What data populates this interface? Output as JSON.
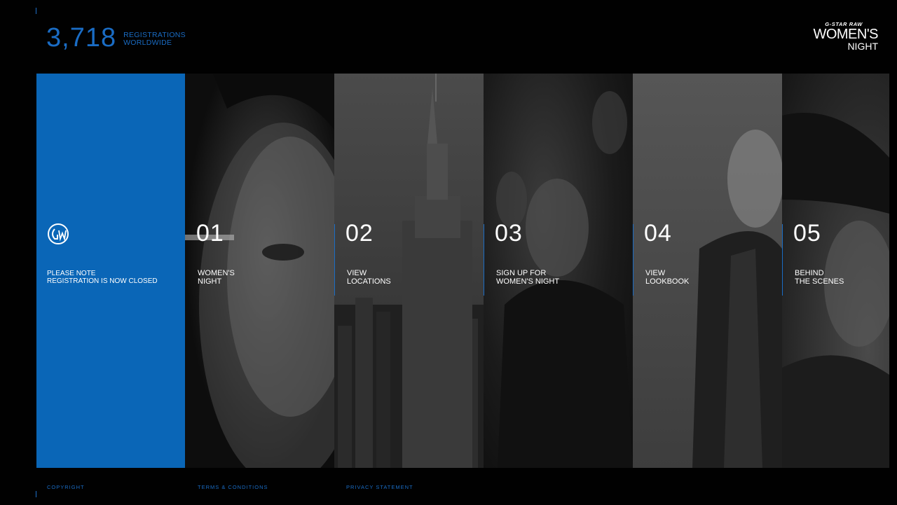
{
  "counter": {
    "number": "3,718",
    "label_line1": "REGISTRATIONS",
    "label_line2": "WORLDWIDE"
  },
  "brand": {
    "top": "G-STAR RAW",
    "mid": "WOMEN'S",
    "bottom": "NIGHT"
  },
  "notice": {
    "line1": "PLEASE NOTE",
    "line2": "REGISTRATION IS NOW CLOSED",
    "logo_icon": "gw-logo-icon"
  },
  "panels": [
    {
      "number": "01",
      "line1": "WOMEN'S",
      "line2": "NIGHT"
    },
    {
      "number": "02",
      "line1": "VIEW",
      "line2": "LOCATIONS"
    },
    {
      "number": "03",
      "line1": "SIGN UP FOR",
      "line2": "WOMEN'S NIGHT"
    },
    {
      "number": "04",
      "line1": "VIEW",
      "line2": "LOOKBOOK"
    },
    {
      "number": "05",
      "line1": "BEHIND",
      "line2": "THE SCENES"
    }
  ],
  "footer": {
    "copyright": "COPYRIGHT",
    "terms": "TERMS & CONDITIONS",
    "privacy": "PRIVACY STATEMENT"
  },
  "colors": {
    "accent_blue": "#0a66b7",
    "text_blue": "#1a6cc4",
    "background": "#010101"
  }
}
